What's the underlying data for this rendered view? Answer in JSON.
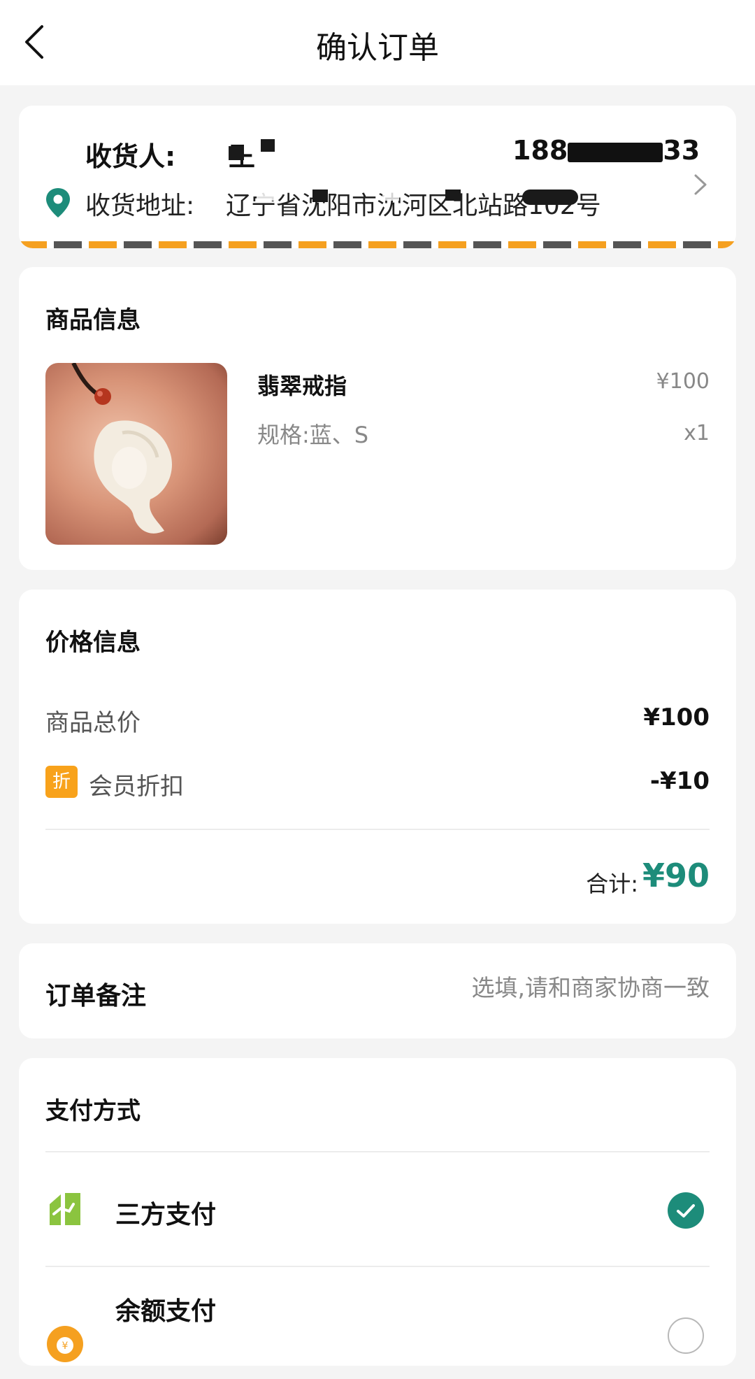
{
  "header": {
    "title": "确认订单",
    "back_icon": "chevron-left-icon"
  },
  "address": {
    "recipient_label": "收货人:",
    "recipient_name": "王",
    "phone": "188",
    "phone_tail": "33",
    "address_label": "收货地址:",
    "address_text": "辽宁省沈阳市沈河区北站路102号",
    "pin_icon": "location-pin-icon",
    "chevron_icon": "chevron-right-icon"
  },
  "goods": {
    "section_title": "商品信息",
    "product_name": "翡翠戒指",
    "spec": "规格:蓝、S",
    "price": "¥100",
    "quantity": "x1"
  },
  "price_info": {
    "section_title": "价格信息",
    "subtotal_label": "商品总价",
    "subtotal_value": "¥100",
    "discount_badge": "折",
    "discount_label": "会员折扣",
    "discount_value": "-¥10",
    "total_label": "合计:",
    "total_value": "¥90",
    "accent_color": "#1d8c7a"
  },
  "note": {
    "title": "订单备注",
    "placeholder": "选填,请和商家协商一致"
  },
  "payment": {
    "section_title": "支付方式",
    "methods": [
      {
        "label": "三方支付",
        "icon": "third-party-pay-icon",
        "selected": true
      },
      {
        "label": "余额支付",
        "icon": "balance-coin-icon",
        "selected": false
      }
    ]
  }
}
